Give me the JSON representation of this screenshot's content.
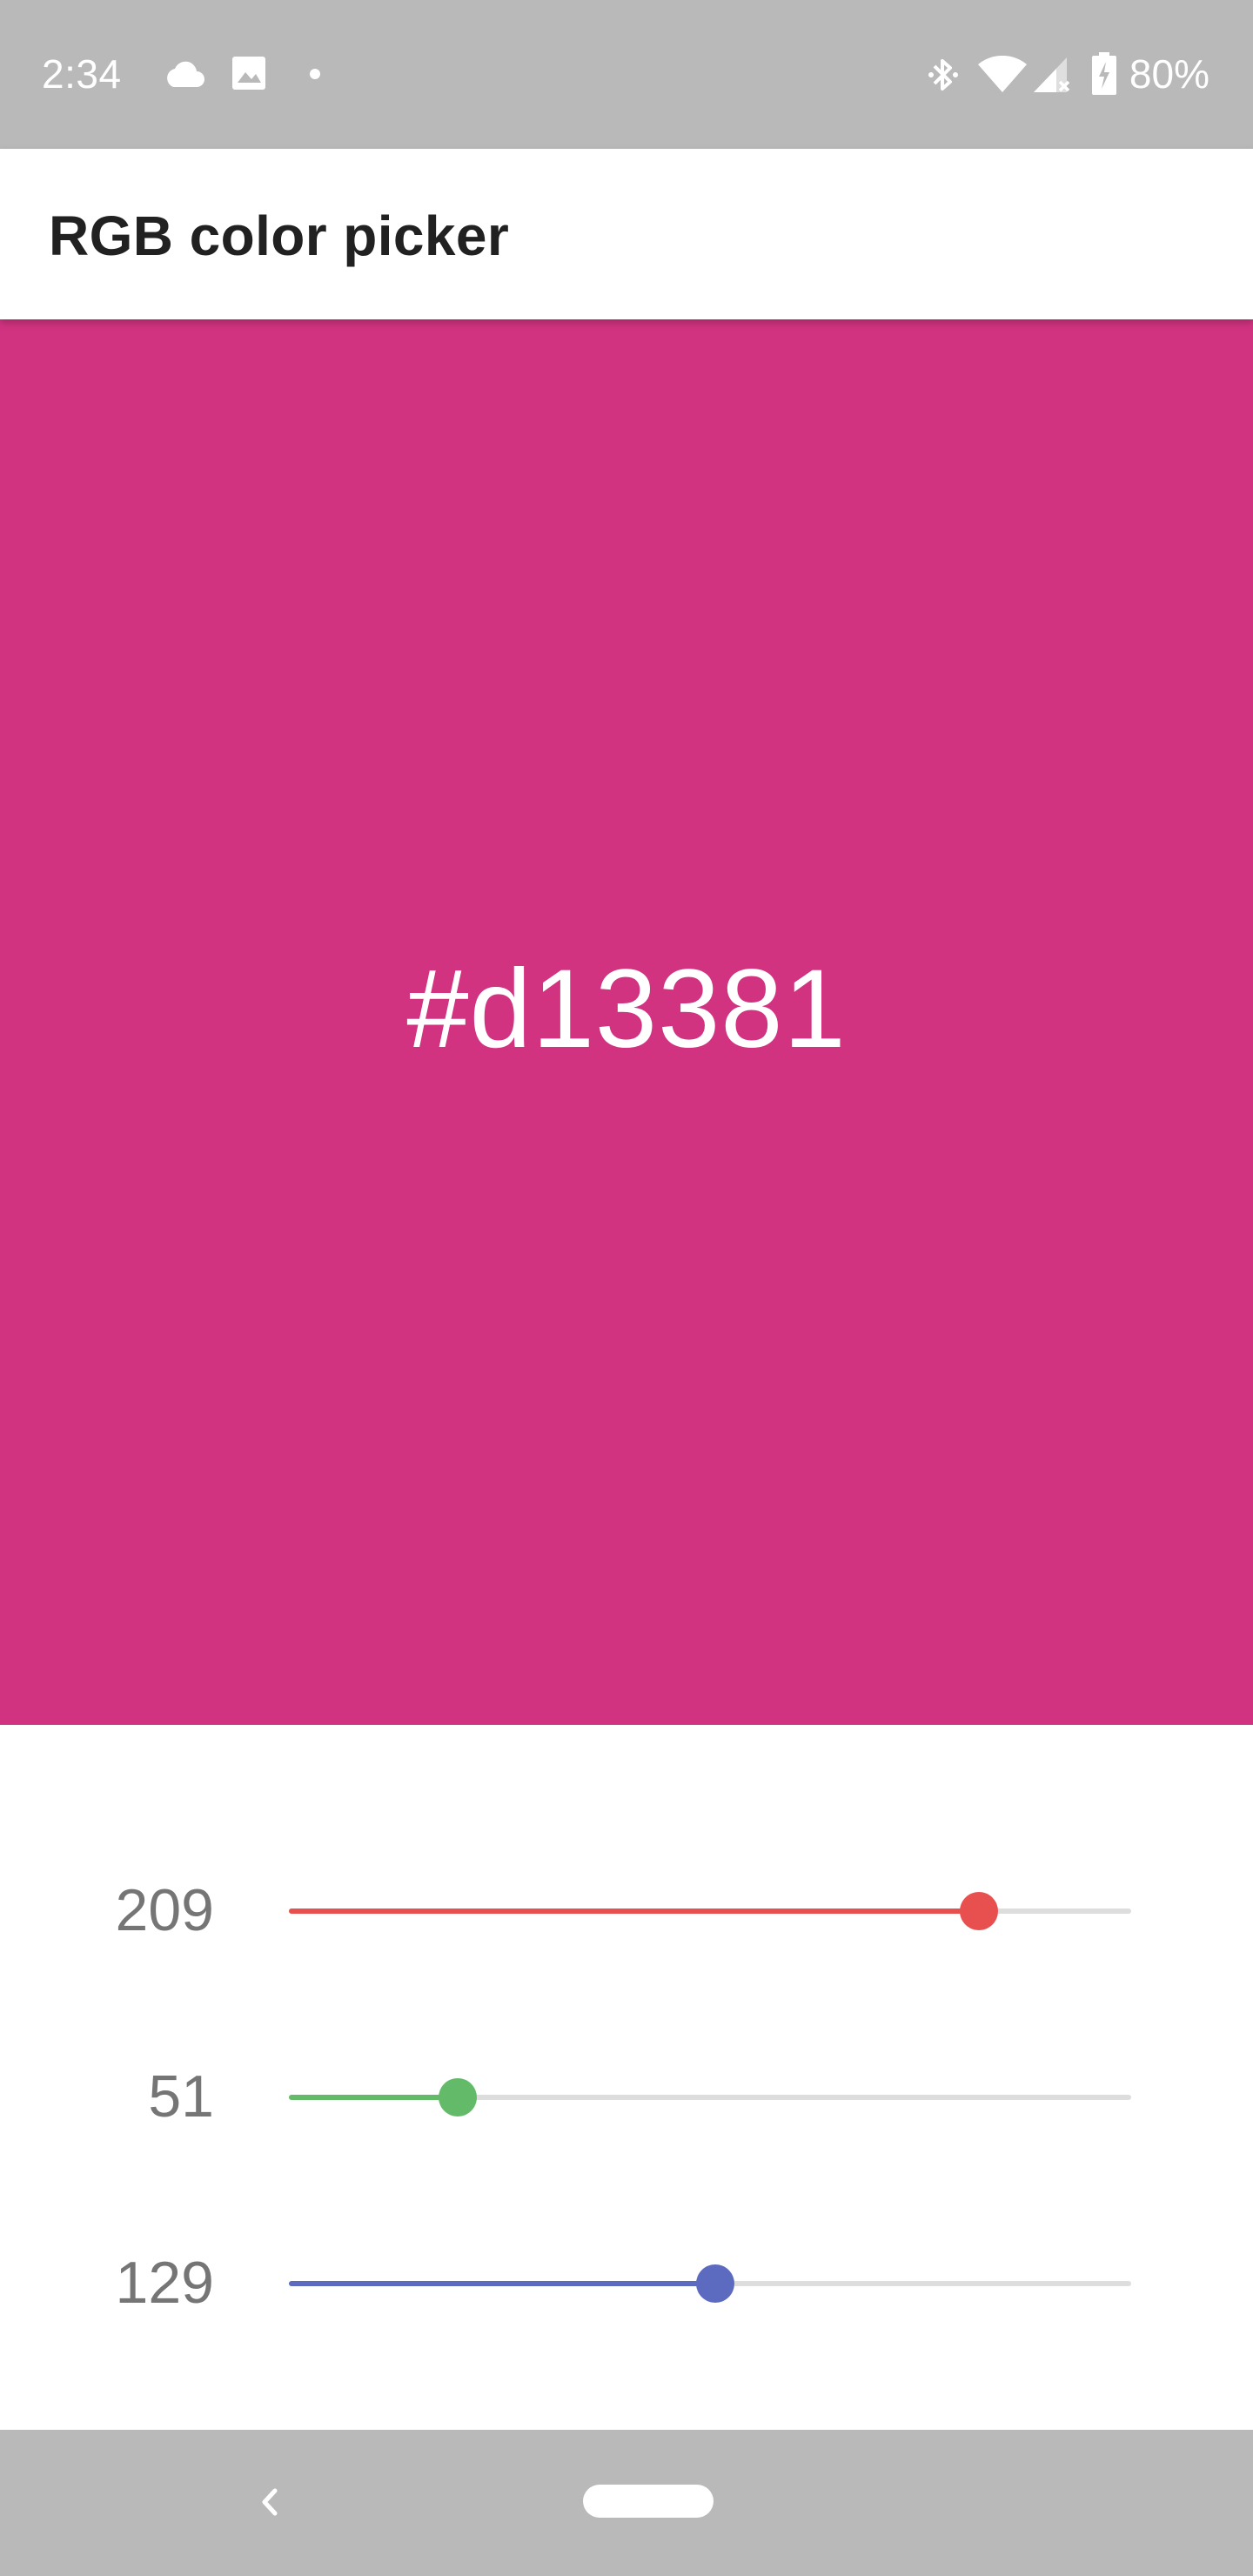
{
  "status_bar": {
    "time": "2:34",
    "battery": "80%",
    "icons": [
      "cloud-icon",
      "image-icon",
      "notification-dot-icon",
      "bluetooth-icon",
      "wifi-icon",
      "cell-signal-icon",
      "battery-icon"
    ]
  },
  "app_bar": {
    "title": "RGB color picker"
  },
  "preview": {
    "hex": "#d13381",
    "color": "#d13381"
  },
  "sliders": [
    {
      "channel": "red",
      "value": "209",
      "fraction": 0.8196,
      "color": "#e85050"
    },
    {
      "channel": "green",
      "value": "51",
      "fraction": 0.2,
      "color": "#63bb69"
    },
    {
      "channel": "blue",
      "value": "129",
      "fraction": 0.5059,
      "color": "#5c6bc0"
    }
  ],
  "nav_bar": {
    "icons": [
      "back-icon",
      "home-pill-icon"
    ]
  }
}
